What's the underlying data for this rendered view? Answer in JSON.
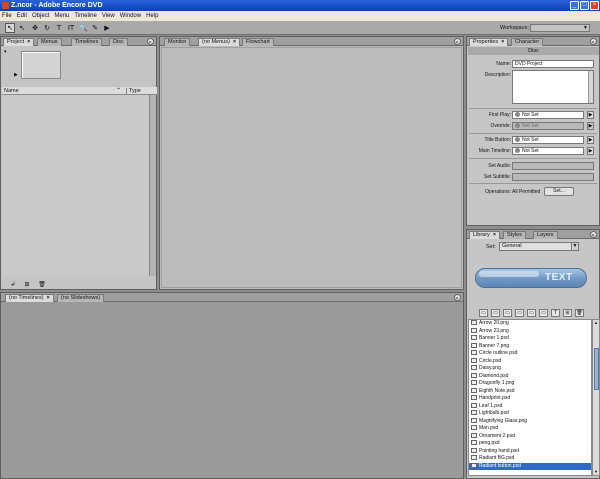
{
  "window": {
    "title": "Z.ncor - Adobe Encore DVD",
    "controls": [
      "_",
      "□",
      "×"
    ]
  },
  "menu": [
    "File",
    "Edit",
    "Object",
    "Menu",
    "Timeline",
    "View",
    "Window",
    "Help"
  ],
  "toolbar": {
    "tools": [
      "selection-tool",
      "direct-select-tool",
      "move-tool",
      "rotate-tool",
      "text-tool",
      "vertical-text-tool",
      "zoom-tool",
      "edit-in-photoshop-tool",
      "preview-tool"
    ],
    "glyphs": [
      "↖",
      "↖",
      "✥",
      "↻",
      "T",
      "IT",
      "🔍",
      "✎",
      "▶"
    ],
    "workspace_label": "Workspace:",
    "workspace_value": ""
  },
  "project_panel": {
    "tabs": [
      "Project",
      "Menus",
      "Timelines",
      "Disc"
    ],
    "columns": {
      "name": "Name",
      "type": "Type"
    },
    "bottom_buttons": [
      "↲",
      "⊞",
      "🗑"
    ]
  },
  "monitor_panel": {
    "tabs": [
      "Monitor",
      "(no Menus)",
      "Flowchart"
    ]
  },
  "properties_panel": {
    "tabs": [
      "Properties",
      "Character"
    ],
    "header": "Disc",
    "name_label": "Name:",
    "name_value": "DVD Project",
    "description_label": "Description:",
    "first_play_label": "First Play:",
    "first_play_value": "Not Set",
    "override_label": "Override:",
    "override_value": "Not Set",
    "title_button_label": "Title Button:",
    "title_button_value": "Not Set",
    "main_timeline_label": "Main Timeline:",
    "main_timeline_value": "Not Set",
    "set_audio_label": "Set Audio:",
    "set_subtitle_label": "Set Subtitle:",
    "operations_label": "Operations:",
    "operations_value": "All Permitted",
    "set_button": "Set..."
  },
  "library_panel": {
    "tabs": [
      "Library",
      "Styles",
      "Layers"
    ],
    "set_label": "Set:",
    "set_value": "General",
    "preview_text": "TEXT",
    "items": [
      "Arrow 20.png",
      "Arrow 23.png",
      "Banner 1.psd",
      "Banner 7.png",
      "Circle outline.psd",
      "Circle.psd",
      "Daisy.png",
      "Diamond.psd",
      "Dragonfly 1.png",
      "Eighth Note.psd",
      "Handprint.psd",
      "Leaf 1.psd",
      "Lightbulb.psd",
      "Magnifying Glass.png",
      "Man.psd",
      "Ornament 2.psd",
      "peng.psd",
      "Pointing hand.psd",
      "Radiant BG.psd",
      "Radiant button.psd"
    ],
    "selected_index": 19
  },
  "timeline_panel": {
    "tabs": [
      "(no Timelines)",
      "(no Slideshows)"
    ]
  },
  "colors": {
    "titlebar": "#0a3fb8",
    "selection": "#316ac5",
    "panel": "#c4c4c4",
    "background": "#8e8e8e"
  }
}
